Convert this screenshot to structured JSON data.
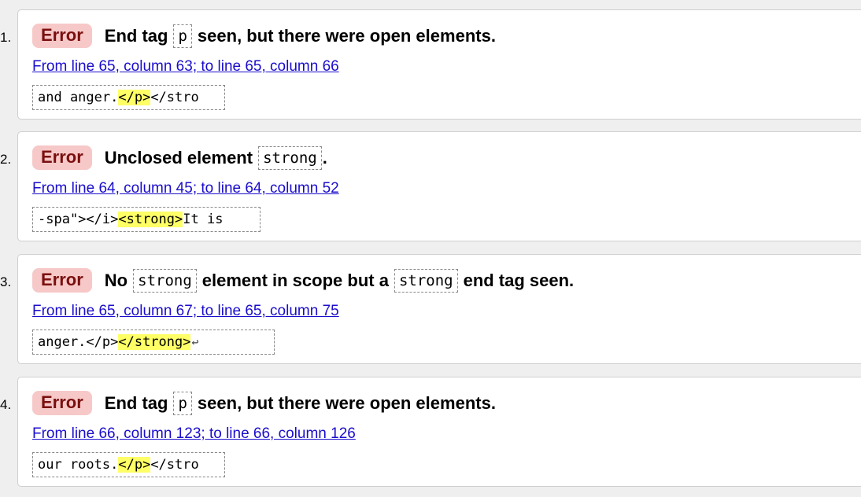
{
  "errors": [
    {
      "number": "1.",
      "type": "Error",
      "message_parts": [
        "End tag",
        "p",
        "seen, but there were open elements."
      ],
      "location": "From line 65, column 63; to line 65, column 66",
      "extract": {
        "before": "and anger.",
        "highlight": "</p>",
        "after": "</stro",
        "linebreak": ""
      }
    },
    {
      "number": "2.",
      "type": "Error",
      "message_parts": [
        "Unclosed element",
        "strong",
        "."
      ],
      "location": "From line 64, column 45; to line 64, column 52",
      "extract": {
        "before": "-spa\"></i>",
        "highlight": "<strong>",
        "after": "It is ",
        "linebreak": ""
      }
    },
    {
      "number": "3.",
      "type": "Error",
      "message_parts": [
        "No",
        "strong",
        "element in scope but a",
        "strong",
        "end tag seen."
      ],
      "location": "From line 65, column 67; to line 65, column 75",
      "extract": {
        "before": "anger.</p>",
        "highlight": "</strong>",
        "after": "",
        "linebreak": "↩"
      }
    },
    {
      "number": "4.",
      "type": "Error",
      "message_parts": [
        "End tag",
        "p",
        "seen, but there were open elements."
      ],
      "location": "From line 66, column 123; to line 66, column 126",
      "extract": {
        "before": "our roots.",
        "highlight": "</p>",
        "after": "</stro",
        "linebreak": ""
      }
    }
  ]
}
